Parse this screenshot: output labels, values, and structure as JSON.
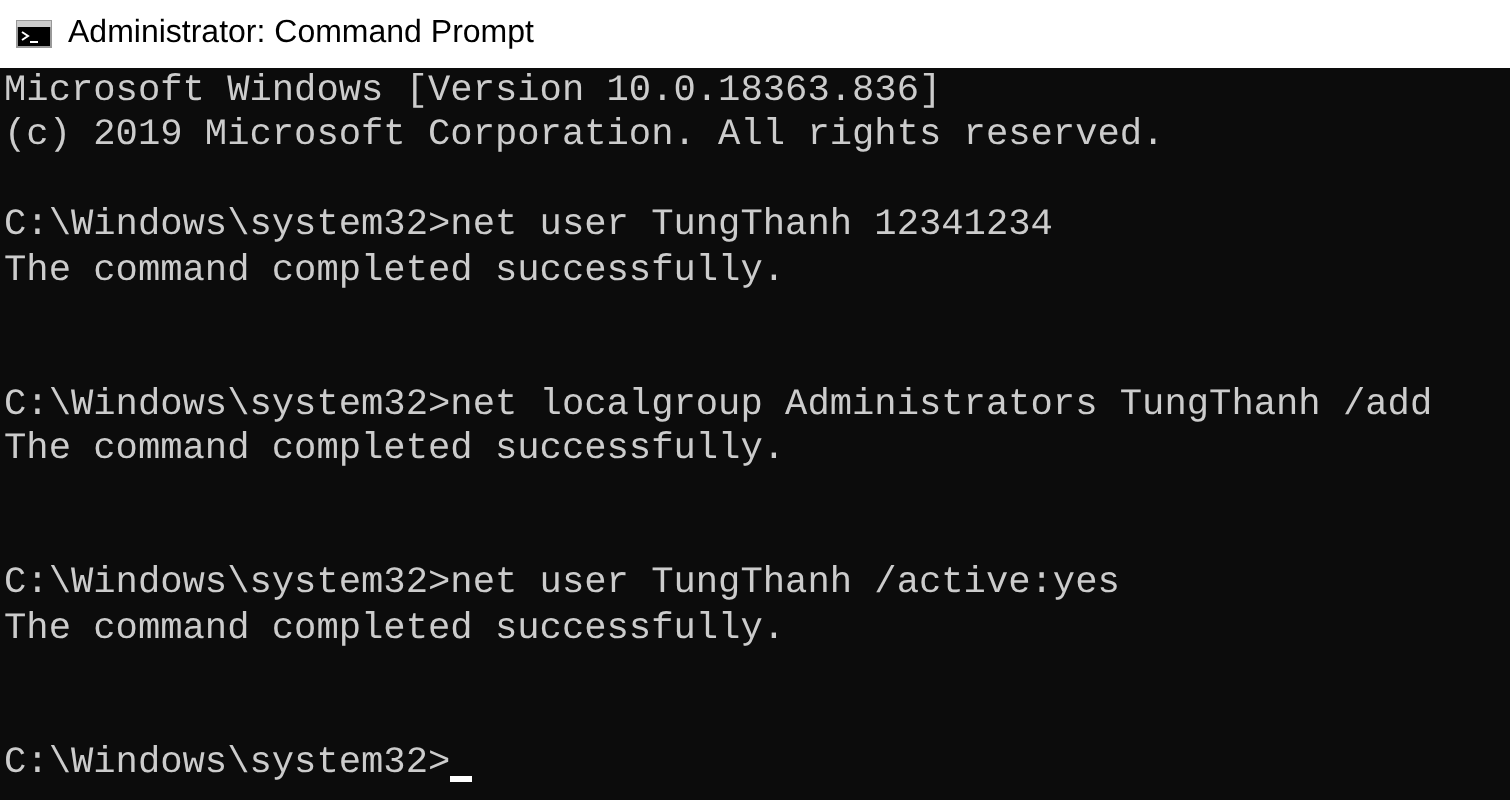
{
  "window": {
    "title": "Administrator: Command Prompt"
  },
  "console": {
    "lines": [
      {
        "kind": "output",
        "text": "Microsoft Windows [Version 10.0.18363.836]"
      },
      {
        "kind": "output",
        "text": "(c) 2019 Microsoft Corporation. All rights reserved."
      },
      {
        "kind": "blank"
      },
      {
        "kind": "output",
        "text": "C:\\Windows\\system32>net user TungThanh 12341234"
      },
      {
        "kind": "output",
        "text": "The command completed successfully."
      },
      {
        "kind": "blank"
      },
      {
        "kind": "blank"
      },
      {
        "kind": "output",
        "text": "C:\\Windows\\system32>net localgroup Administrators TungThanh /add"
      },
      {
        "kind": "output",
        "text": "The command completed successfully."
      },
      {
        "kind": "blank"
      },
      {
        "kind": "blank"
      },
      {
        "kind": "output",
        "text": "C:\\Windows\\system32>net user TungThanh /active:yes"
      },
      {
        "kind": "output",
        "text": "The command completed successfully."
      },
      {
        "kind": "blank"
      },
      {
        "kind": "blank"
      },
      {
        "kind": "prompt",
        "text": "C:\\Windows\\system32>"
      }
    ]
  }
}
